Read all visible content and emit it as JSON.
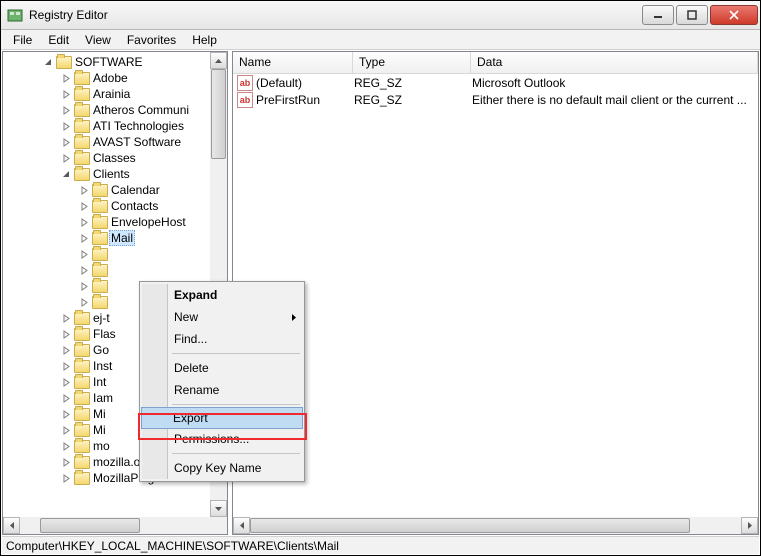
{
  "window": {
    "title": "Registry Editor"
  },
  "menubar": [
    "File",
    "Edit",
    "View",
    "Favorites",
    "Help"
  ],
  "tree": {
    "root": "SOFTWARE",
    "items": [
      {
        "indent": 1,
        "label": "SOFTWARE",
        "expanded": true
      },
      {
        "indent": 2,
        "label": "Adobe"
      },
      {
        "indent": 2,
        "label": "Arainia"
      },
      {
        "indent": 2,
        "label": "Atheros Communi"
      },
      {
        "indent": 2,
        "label": "ATI Technologies"
      },
      {
        "indent": 2,
        "label": "AVAST Software"
      },
      {
        "indent": 2,
        "label": "Classes"
      },
      {
        "indent": 2,
        "label": "Clients",
        "expanded": true
      },
      {
        "indent": 3,
        "label": "Calendar"
      },
      {
        "indent": 3,
        "label": "Contacts"
      },
      {
        "indent": 3,
        "label": "EnvelopeHost"
      },
      {
        "indent": 3,
        "label": "Mail",
        "selected": true,
        "truncated": true
      },
      {
        "indent": 3,
        "label": ""
      },
      {
        "indent": 3,
        "label": ""
      },
      {
        "indent": 3,
        "label": ""
      },
      {
        "indent": 3,
        "label": ""
      },
      {
        "indent": 2,
        "label": "ej-t",
        "truncated": true
      },
      {
        "indent": 2,
        "label": "Flas",
        "truncated": true
      },
      {
        "indent": 2,
        "label": "Go",
        "truncated": true
      },
      {
        "indent": 2,
        "label": "Inst",
        "truncated": true
      },
      {
        "indent": 2,
        "label": "Int",
        "truncated": true
      },
      {
        "indent": 2,
        "label": "Iam",
        "truncated": true
      },
      {
        "indent": 2,
        "label": "Mi",
        "truncated": true
      },
      {
        "indent": 2,
        "label": "Mi",
        "truncated": true
      },
      {
        "indent": 2,
        "label": "mo",
        "truncated": true
      },
      {
        "indent": 2,
        "label": "mozilla.org"
      },
      {
        "indent": 2,
        "label": "MozillaPlugins"
      }
    ]
  },
  "list": {
    "headers": {
      "name": "Name",
      "type": "Type",
      "data": "Data"
    },
    "rows": [
      {
        "name": "(Default)",
        "type": "REG_SZ",
        "data": "Microsoft Outlook"
      },
      {
        "name": "PreFirstRun",
        "type": "REG_SZ",
        "data": "Either there is no default mail client or the current ..."
      }
    ]
  },
  "context_menu": {
    "items": [
      {
        "label": "Expand",
        "bold": true
      },
      {
        "label": "New",
        "submenu": true
      },
      {
        "label": "Find..."
      },
      {
        "sep": true
      },
      {
        "label": "Delete"
      },
      {
        "label": "Rename"
      },
      {
        "sep": true
      },
      {
        "label": "Export",
        "highlighted": true
      },
      {
        "label": "Permissions..."
      },
      {
        "sep": true
      },
      {
        "label": "Copy Key Name"
      }
    ]
  },
  "statusbar": "Computer\\HKEY_LOCAL_MACHINE\\SOFTWARE\\Clients\\Mail"
}
